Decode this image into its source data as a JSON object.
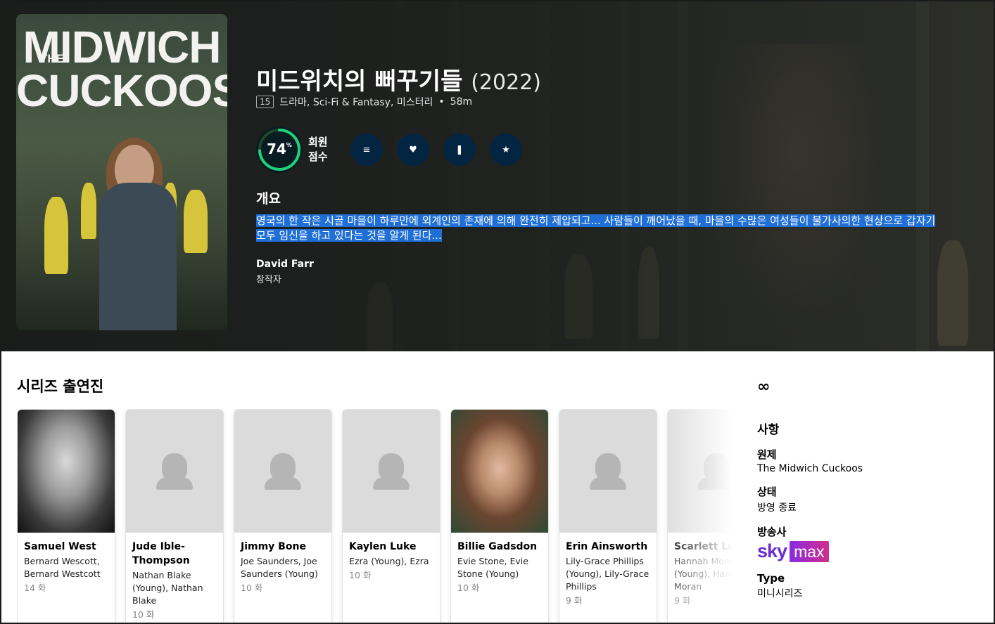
{
  "hero": {
    "poster": {
      "the": "THE",
      "title_line1": "MIDWICH",
      "title_line2": "CUCKOOS"
    },
    "title": "미드위치의 뻐꾸기들",
    "year": "(2022)",
    "certification": "15",
    "genres": "드라마, Sci-Fi & Fantasy, 미스터리",
    "separator": "•",
    "runtime": "58m",
    "score": {
      "value": "74",
      "unit": "%",
      "fraction": 0.74,
      "label_line1": "회원",
      "label_line2": "점수",
      "ring_color": "#21d07a",
      "track_color": "#204529"
    },
    "actions": [
      {
        "name": "add-to-list",
        "icon": "list-icon",
        "glyph": "≡"
      },
      {
        "name": "favorite",
        "icon": "heart-icon",
        "glyph": "♥"
      },
      {
        "name": "watchlist",
        "icon": "bookmark-icon",
        "glyph": "❚"
      },
      {
        "name": "rate",
        "icon": "star-icon",
        "glyph": "★"
      }
    ],
    "overview_heading": "개요",
    "overview": "영국의 한 작은 시골 마을이 하루만에 외계인의 존재에 의해 완전히 제압되고... 사람들이 깨어났을 때, 마을의 수많은 여성들이 불가사의한 현상으로 갑자기 모두 임신을 하고 있다는 것을 알게 된다...",
    "creator": {
      "name": "David Farr",
      "role": "창작자"
    }
  },
  "cast": {
    "heading": "시리즈 출연진",
    "members": [
      {
        "name": "Samuel West",
        "character": "Bernard Wescott, Bernard Westcott",
        "episodes": "14 화",
        "has_photo": true
      },
      {
        "name": "Jude Ible-Thompson",
        "character": "Nathan Blake (Young), Nathan Blake",
        "episodes": "10 화",
        "has_photo": false
      },
      {
        "name": "Jimmy Bone",
        "character": "Joe Saunders, Joe Saunders (Young)",
        "episodes": "10 화",
        "has_photo": false
      },
      {
        "name": "Kaylen Luke",
        "character": "Ezra (Young), Ezra",
        "episodes": "10 화",
        "has_photo": false
      },
      {
        "name": "Billie Gadsdon",
        "character": "Evie Stone, Evie Stone (Young)",
        "episodes": "10 화",
        "has_photo": true
      },
      {
        "name": "Erin Ainsworth",
        "character": "Lily-Grace Phillips (Young), Lily-Grace Phillips",
        "episodes": "9 화",
        "has_photo": false
      },
      {
        "name": "Scarlett Leigh",
        "character": "Hannah Moran (Young), Hannah Moran",
        "episodes": "9 화",
        "has_photo": false
      }
    ]
  },
  "sidebar": {
    "link_icon": "link-icon",
    "facts_heading": "사항",
    "original_title_label": "원제",
    "original_title": "The Midwich Cuckoos",
    "status_label": "상태",
    "status": "방영 종료",
    "network_label": "방송사",
    "network": {
      "part1": "sky",
      "part2": "max"
    },
    "type_label": "Type",
    "type": "미니시리즈"
  }
}
